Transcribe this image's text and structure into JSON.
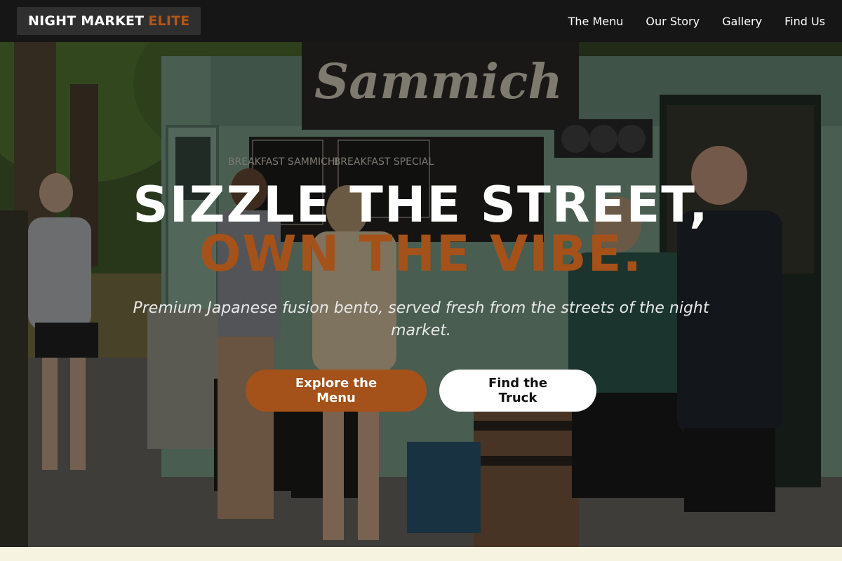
{
  "nav": {
    "logo_main": "NIGHT MARKET",
    "logo_accent": "ELITE",
    "links": [
      "The Menu",
      "Our Story",
      "Gallery",
      "Find Us"
    ]
  },
  "hero": {
    "headline_line1": "SIZZLE THE STREET,",
    "headline_line2": "OWN THE VIBE.",
    "tagline": "Premium Japanese fusion bento, served fresh from the streets of the night market.",
    "primary_cta": "Explore the Menu",
    "secondary_cta": "Find the Truck",
    "truck_sign": "Sammich",
    "board_left": "BREAKFAST SAMMICHES",
    "board_right": "BREAKFAST SPECIAL"
  },
  "colors": {
    "accent": "#a4521a",
    "nav_bg": "#161616",
    "page_bg": "#f6f4e1"
  }
}
